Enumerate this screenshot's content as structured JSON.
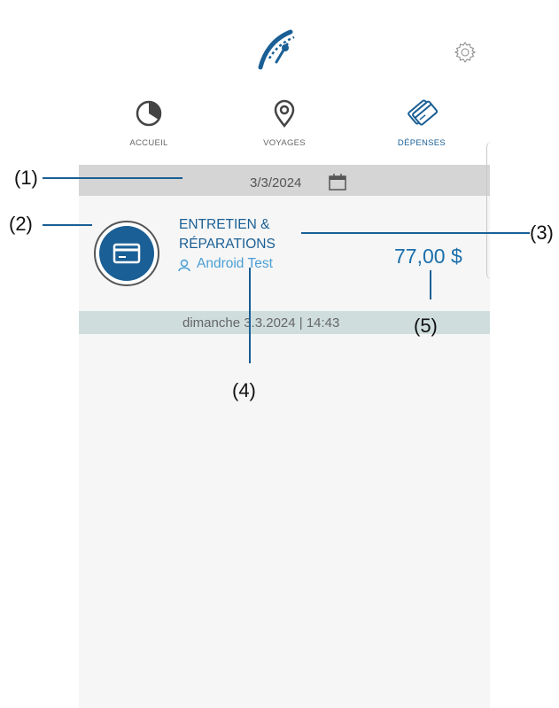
{
  "tabs": [
    {
      "label": "ACCUEIL",
      "icon": "pie-chart-icon",
      "active": false
    },
    {
      "label": "VOYAGES",
      "icon": "map-pin-icon",
      "active": false
    },
    {
      "label": "DÉPENSES",
      "icon": "credit-cards-icon",
      "active": true
    }
  ],
  "date_bar": {
    "date": "3/3/2024",
    "icon": "calendar-icon"
  },
  "expense": {
    "category_line1": "ENTRETIEN &",
    "category_line2": "RÉPARATIONS",
    "user": "Android Test",
    "amount": "77,00 $",
    "timestamp": "dimanche 3.3.2024 | 14:43",
    "icon": "credit-card-icon"
  },
  "callouts": {
    "c1": "(1)",
    "c2": "(2)",
    "c3": "(3)",
    "c4": "(4)",
    "c5": "(5)"
  },
  "colors": {
    "accent": "#1a5f95",
    "amount": "#1a6fab",
    "user": "#4a9fd4",
    "date_bar": "#d5d5d5",
    "timestamp_bar": "#cfdddd"
  }
}
